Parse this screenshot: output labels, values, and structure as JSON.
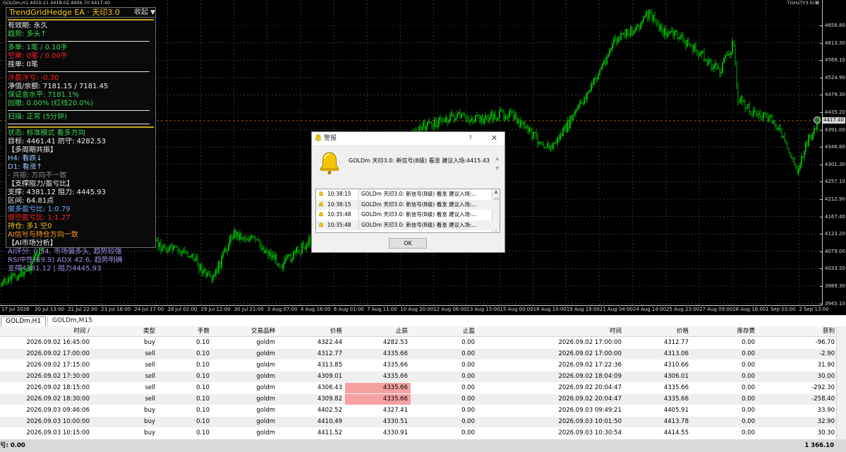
{
  "chart": {
    "symbol_info": "GOLDm,H1  4410.21 4418.02 4406.70 4417.40",
    "indicator_tag": "TGHxTY3.0(1)",
    "current_price": "4417.40",
    "price_labels": [
      "4658.80",
      "4613.30",
      "4569.10",
      "4524.90",
      "4479.30",
      "4435.20",
      "4391.00",
      "4346.80",
      "4301.30",
      "4257.10",
      "4212.90",
      "4167.40",
      "4123.20",
      "4079.00",
      "4033.50",
      "3989.30",
      "3945.10"
    ],
    "time_labels": [
      "17 Jul 2026",
      "20 Jul 13:00",
      "21 Jul 22:00",
      "23 Jul 18:00",
      "24 Jul 17:00",
      "28 Jul 02:00",
      "29 Jul 12:00",
      "30 Jul 21:00",
      "3 Aug 07:00",
      "4 Aug 16:00",
      "6 Aug 01:00",
      "7 Aug 11:00",
      "10 Aug 20:00",
      "12 Aug 06:00",
      "13 Aug 15:00",
      "15 Aug 00:00",
      "18 Aug 10:00",
      "19 Aug 19:00",
      "21 Aug 04:00",
      "24 Aug 14:00",
      "25 Aug 23:00",
      "27 Aug 09:00",
      "28 Aug 18:00",
      "1 Sep 03:00",
      "2 Sep 13:00"
    ],
    "candle_color": "#00d000",
    "ref_line_color": "#c87a00"
  },
  "panel": {
    "title": "TrendGridHedge EA · 天印3.0",
    "collapse": "收起",
    "validity": "有效期: 永久",
    "trend": "趋势: 多头↑",
    "buy": "多单: 1笔 / 0.10手",
    "sell": "空单: 0笔 / 0.00手",
    "pending": "挂单: 0笔",
    "float_pl": "浮盈浮亏: -0.30",
    "equity": "净值/余额: 7181.15 / 7181.45",
    "margin": "保证金水平: 7181.1%",
    "drawdown": "回撤: 0.00% (红线20.0%)",
    "scan": "扫描: 正常 (5分钟)",
    "status": "状态: 标准模式 看多方向",
    "target": "目标: 4461.41  防守: 4282.53",
    "multi_cycle": "【多周期共振】",
    "h4": "H4: 看跌↓",
    "d1": "D1: 看涨↑",
    "conflict": "- 共振: 方向不一致",
    "sr_header": "【支撑阻力/盈亏比】",
    "sr": "支撑: 4381.12  阻力: 4445.93",
    "range": "区间: 64.81点",
    "long_rr": "做多盈亏比: 1:0.79",
    "short_rr": "做空盈亏比: 1:1.27",
    "hold": "持仓: 多1 空0",
    "ai_consistent": "AI信号与持仓方向一致",
    "ai_header": "【AI市场分析】",
    "ai_score": "AI评分: 0.54, 市场偏多头, 趋势较强",
    "rsi": "RSI中性(69.9)  ADX 42.6, 趋势明确",
    "support": "支撑4381.12 | 阻力4445.93"
  },
  "alert": {
    "title": "警报",
    "question": "?",
    "close": "✕",
    "message": "GOLDm 天印3.0: 新信号(B级) 看涨 建议入场:4415.43",
    "rows": [
      {
        "time": "10:38:15",
        "msg": "GOLDm 天印3.0: 新信号(B级) 看涨 建议入场:..."
      },
      {
        "time": "10:38:15",
        "msg": "GOLDm 天印3.0: 新信号(B级) 看涨 建议入场:..."
      },
      {
        "time": "10:35:48",
        "msg": "GOLDm 天印3.0: 新信号(B级) 看涨 建议入场:..."
      },
      {
        "time": "10:35:48",
        "msg": "GOLDm 天印3.0: 新信号(B级) 看涨 建议入场:..."
      }
    ],
    "ok": "OK"
  },
  "tabs": {
    "active": "GOLDm,H1",
    "inactive": "GOLDm,M15"
  },
  "table": {
    "headers": [
      "时间 /",
      "类型",
      "手数",
      "交易品种",
      "价格",
      "止损",
      "止盈",
      "时间",
      "价格",
      "库存费",
      "获利"
    ],
    "rows": [
      [
        "2026.09.02 16:45:00",
        "buy",
        "0.10",
        "goldm",
        "4322.44",
        "4282.53",
        "0.00",
        "2026.09.02 17:00:00",
        "4312.77",
        "0.00",
        "-96.70"
      ],
      [
        "2026.09.02 17:00:00",
        "sell",
        "0.10",
        "goldm",
        "4312.77",
        "4335.66",
        "0.00",
        "2026.09.02 17:00:00",
        "4313.06",
        "0.00",
        "-2.90"
      ],
      [
        "2026.09.02 17:15:00",
        "sell",
        "0.10",
        "goldm",
        "4313.85",
        "4335.66",
        "0.00",
        "2026.09.02 17:22:36",
        "4310.66",
        "0.00",
        "31.90"
      ],
      [
        "2026.09.02 17:30:00",
        "sell",
        "0.10",
        "goldm",
        "4309.01",
        "4335.66",
        "0.00",
        "2026.09.02 18:04:09",
        "4306.01",
        "0.00",
        "30.00"
      ],
      [
        "2026.09.02 18:15:00",
        "sell",
        "0.10",
        "goldm",
        "4306.43",
        "4335.66",
        "0.00",
        "2026.09.02 20:04:47",
        "4335.66",
        "0.00",
        "-292.30"
      ],
      [
        "2026.09.02 18:30:00",
        "sell",
        "0.10",
        "goldm",
        "4309.82",
        "4335.66",
        "0.00",
        "2026.09.02 20:04:47",
        "4335.66",
        "0.00",
        "-258.40"
      ],
      [
        "2026.09.03 09:46:06",
        "buy",
        "0.10",
        "goldm",
        "4402.52",
        "4327.41",
        "0.00",
        "2026.09.03 09:49:21",
        "4405.91",
        "0.00",
        "33.90"
      ],
      [
        "2026.09.03 10:00:00",
        "buy",
        "0.10",
        "goldm",
        "4410.49",
        "4330.51",
        "0.00",
        "2026.09.03 10:01:50",
        "4413.78",
        "0.00",
        "32.90"
      ],
      [
        "2026.09.03 10:15:00",
        "buy",
        "0.10",
        "goldm",
        "4411.52",
        "4330.91",
        "0.00",
        "2026.09.03 10:30:54",
        "4414.55",
        "0.00",
        "30.30"
      ]
    ],
    "highlight_rows": [
      4,
      5
    ],
    "highlight_color": "#f7a0a0"
  },
  "footer": {
    "left": "亏: 0.00",
    "right": "1 366.10"
  }
}
